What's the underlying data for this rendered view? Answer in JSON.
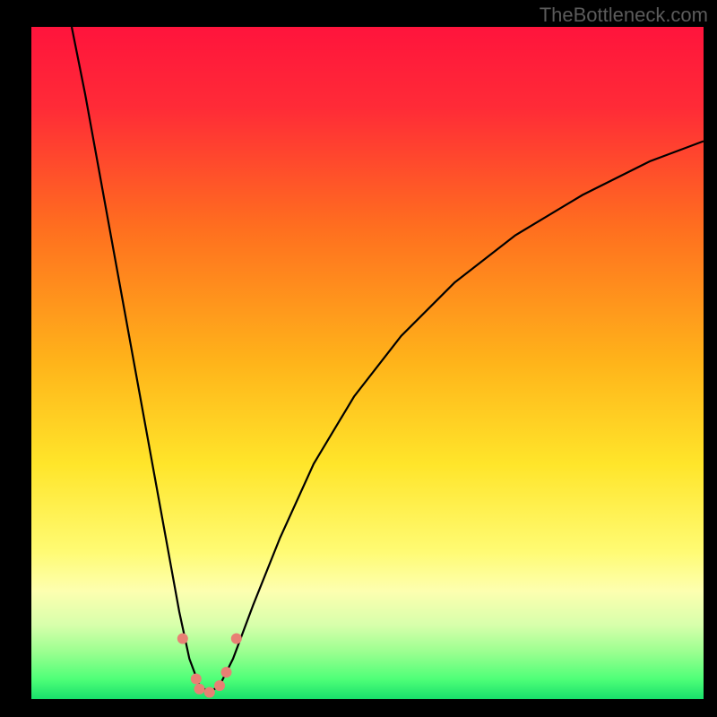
{
  "watermark": "TheBottleneck.com",
  "chart_data": {
    "type": "line",
    "title": "",
    "xlabel": "",
    "ylabel": "",
    "xlim": [
      0,
      100
    ],
    "ylim": [
      0,
      100
    ],
    "background": {
      "type": "vertical-gradient",
      "description": "red→orange→yellow→pale-yellow→green bottleneck gradient",
      "stops": [
        {
          "pct": 0,
          "color": "#ff143c"
        },
        {
          "pct": 12,
          "color": "#ff2b37"
        },
        {
          "pct": 30,
          "color": "#ff6f1f"
        },
        {
          "pct": 50,
          "color": "#ffb41a"
        },
        {
          "pct": 65,
          "color": "#ffe52a"
        },
        {
          "pct": 78,
          "color": "#fffb73"
        },
        {
          "pct": 84,
          "color": "#fdffb0"
        },
        {
          "pct": 89,
          "color": "#d7ffab"
        },
        {
          "pct": 93,
          "color": "#9bff90"
        },
        {
          "pct": 97,
          "color": "#4fff78"
        },
        {
          "pct": 100,
          "color": "#18e06b"
        }
      ]
    },
    "series": [
      {
        "name": "bottleneck-curve",
        "color": "#000000",
        "x": [
          6,
          8,
          10,
          12,
          14,
          16,
          18,
          20,
          22,
          23.5,
          25,
          26.5,
          28,
          30,
          33,
          37,
          42,
          48,
          55,
          63,
          72,
          82,
          92,
          100
        ],
        "y": [
          100,
          90,
          79,
          68,
          57,
          46,
          35,
          24,
          13,
          6,
          2,
          1,
          2,
          6,
          14,
          24,
          35,
          45,
          54,
          62,
          69,
          75,
          80,
          83
        ]
      }
    ],
    "markers": {
      "name": "highlight-points",
      "color": "#e88074",
      "radius_px": 6,
      "points": [
        {
          "x": 22.5,
          "y": 9
        },
        {
          "x": 24.5,
          "y": 3
        },
        {
          "x": 25.0,
          "y": 1.5
        },
        {
          "x": 26.5,
          "y": 1
        },
        {
          "x": 28.0,
          "y": 2
        },
        {
          "x": 29.0,
          "y": 4
        },
        {
          "x": 30.5,
          "y": 9
        }
      ]
    }
  }
}
